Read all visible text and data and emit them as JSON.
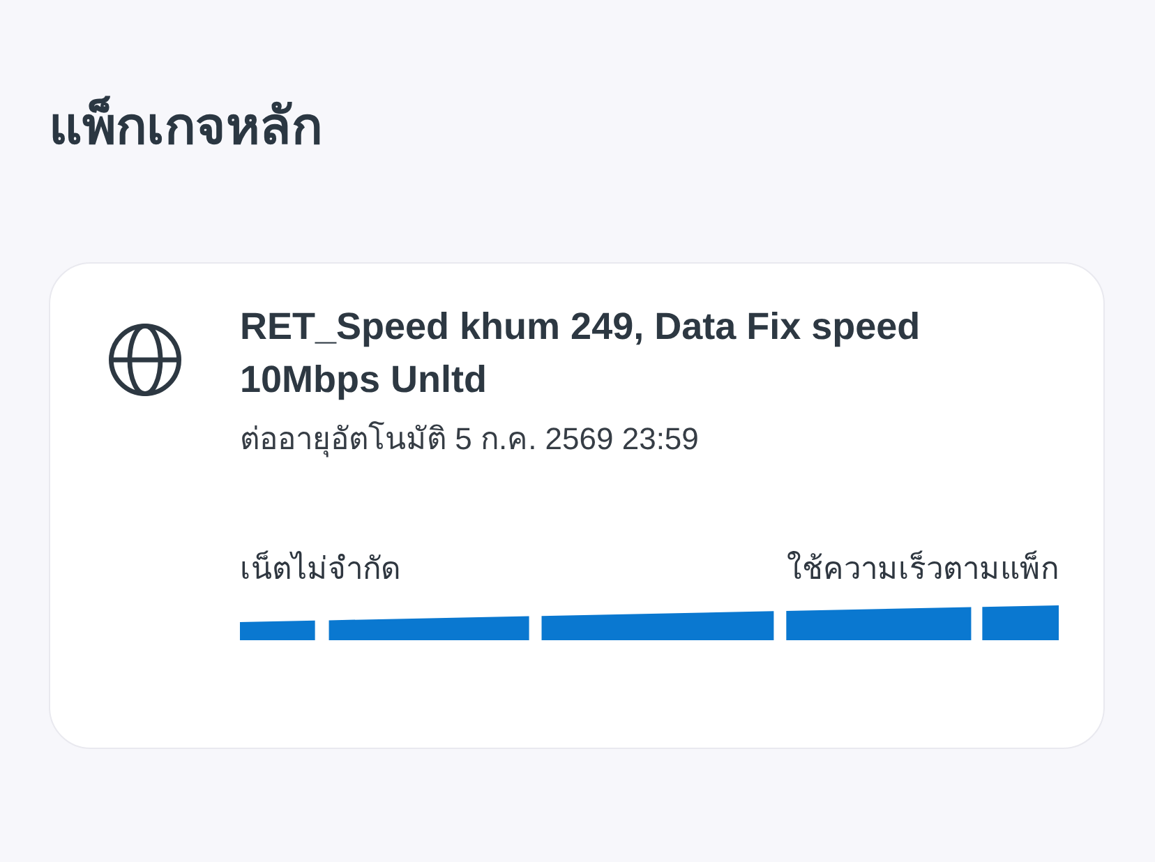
{
  "heading": "แพ็กเกจหลัก",
  "package": {
    "name": "RET_Speed khum 249, Data Fix speed 10Mbps Unltd",
    "renewal": "ต่ออายุอัตโนมัติ 5 ก.ค. 2569 23:59",
    "data_label": "เน็ตไม่จำกัด",
    "speed_label": "ใช้ความเร็วตามแพ็ก"
  }
}
